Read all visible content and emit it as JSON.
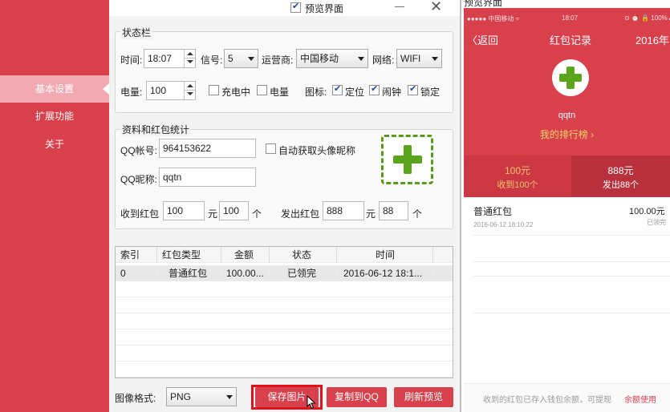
{
  "sidebar": {
    "items": [
      {
        "label": "基本设置",
        "active": true
      },
      {
        "label": "扩展功能",
        "active": false
      },
      {
        "label": "关于",
        "active": false
      }
    ]
  },
  "topbar": {
    "preview_label": "预览界面",
    "preview_checked": true
  },
  "status_bar": {
    "title": "状态栏",
    "time_label": "时间:",
    "time_value": "18:07",
    "signal_label": "信号:",
    "signal_value": "5",
    "carrier_label": "运营商:",
    "carrier_value": "中国移动",
    "network_label": "网络:",
    "network_value": "WIFI",
    "battery_label": "电量:",
    "battery_value": "100",
    "charging_label": "充电中",
    "charging_checked": false,
    "battery_chk_label": "电量",
    "battery_chk_checked": false,
    "icons_label": "图标:",
    "location_label": "定位",
    "location_checked": true,
    "alarm_label": "闹钟",
    "alarm_checked": true,
    "lock_label": "锁定",
    "lock_checked": true
  },
  "profile": {
    "title": "资料和红包统计",
    "qq_label": "QQ帐号:",
    "qq_value": "964153622",
    "auto_label": "自动获取头像昵称",
    "auto_checked": false,
    "nick_label": "QQ昵称:",
    "nick_value": "qqtn",
    "received_label": "收到红包",
    "received_amount": "100",
    "yuan1": "元",
    "received_count": "100",
    "ge1": "个",
    "sent_label": "发出红包",
    "sent_amount": "888",
    "yuan2": "元",
    "sent_count": "88",
    "ge2": "个"
  },
  "table": {
    "headers": [
      "索引",
      "红包类型",
      "金额",
      "状态",
      "时间"
    ],
    "rows": [
      [
        "0",
        "普通红包",
        "100.00...",
        "已领完",
        "2016-06-12 18:1..."
      ]
    ]
  },
  "bottom": {
    "format_label": "图像格式:",
    "format_value": "PNG",
    "save_label": "保存图片",
    "copy_label": "复制到QQ",
    "refresh_label": "刷新预览"
  },
  "preview": {
    "title": "预览界面",
    "status_left": "●●●●● 中国移动 ≈",
    "status_time": "18:07",
    "status_right": "⊙ ⏰ 🔒 100% ▬",
    "back_label": "〈返回",
    "page_title": "红包记录",
    "year_label": "2016年",
    "nickname": "qqtn",
    "rank_link": "我的排行榜 ›",
    "received_amount": "100元",
    "received_caption": "收到100个",
    "sent_amount": "888元",
    "sent_caption": "发出88个",
    "record": {
      "type": "普通红包",
      "time": "2016-06-12 18:10:22",
      "amount": "100.00元",
      "status": "已领完"
    },
    "footer_text": "收到的红包已存入钱包余额，可提现",
    "footer_link": "余额使用"
  },
  "colors": {
    "accent": "#d8404c",
    "highlight": "#e3101a",
    "avatar_green": "#5aa51c"
  }
}
